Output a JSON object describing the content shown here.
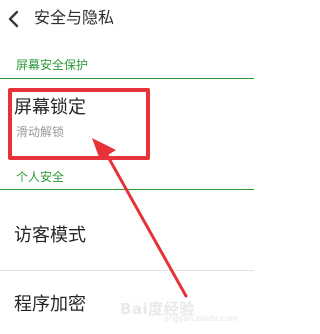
{
  "header": {
    "title": "安全与隐私",
    "back_icon": "chevron-left-icon"
  },
  "sections": {
    "screen_protection": {
      "label": "屏幕安全保护"
    },
    "personal_security": {
      "label": "个人安全"
    }
  },
  "items": {
    "screen_lock": {
      "label": "屏幕锁定",
      "subtitle": "滑动解锁"
    },
    "guest_mode": {
      "label": "访客模式"
    },
    "app_encryption": {
      "label": "程序加密"
    }
  },
  "watermark": {
    "text": "Bai度经验",
    "sub": "jingyan.baidu.com"
  },
  "colors": {
    "accent_green": "#2f9b3a",
    "annotation_red": "#e8323a"
  }
}
